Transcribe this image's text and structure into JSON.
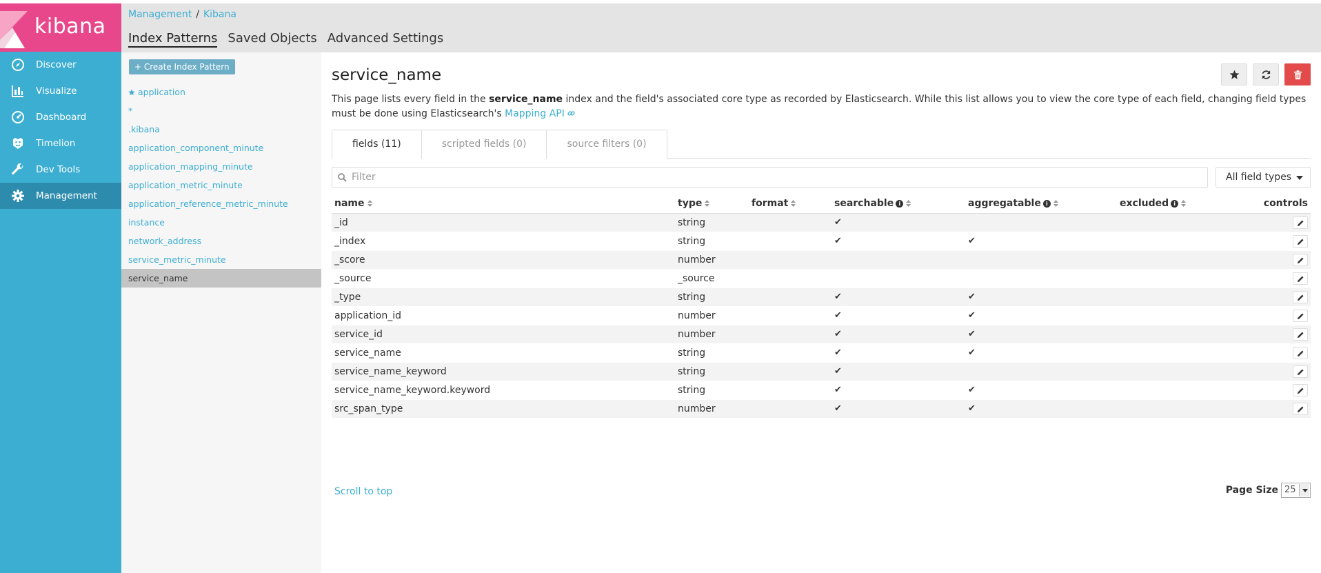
{
  "brand": {
    "name": "kibana"
  },
  "nav": [
    {
      "label": "Discover",
      "icon": "compass-icon"
    },
    {
      "label": "Visualize",
      "icon": "bar-chart-icon"
    },
    {
      "label": "Dashboard",
      "icon": "dashboard-icon"
    },
    {
      "label": "Timelion",
      "icon": "timelion-icon"
    },
    {
      "label": "Dev Tools",
      "icon": "wrench-icon"
    },
    {
      "label": "Management",
      "icon": "gear-icon",
      "active": true
    }
  ],
  "breadcrumb": {
    "first": "Management",
    "sep": "/",
    "second": "Kibana"
  },
  "tabs": {
    "index_patterns": "Index Patterns",
    "saved_objects": "Saved Objects",
    "advanced_settings": "Advanced Settings"
  },
  "index_panel": {
    "create_label": "+ Create Index Pattern",
    "items": [
      "application",
      "*",
      ".kibana",
      "application_component_minute",
      "application_mapping_minute",
      "application_metric_minute",
      "application_reference_metric_minute",
      "instance",
      "network_address",
      "service_metric_minute",
      "service_name"
    ],
    "default_item": "application",
    "active_item": "service_name"
  },
  "main": {
    "title": "service_name",
    "desc": {
      "part1": "This page lists every field in the ",
      "index": "service_name",
      "part2": " index and the field's associated core type as recorded by Elasticsearch. While this list allows you to view the core type of each field, changing field types must be done using Elasticsearch's ",
      "link": "Mapping API"
    },
    "field_tabs": {
      "fields": "fields (11)",
      "scripted": "scripted fields (0)",
      "source": "source filters (0)"
    },
    "filter_placeholder": "Filter",
    "type_select": "All field types",
    "columns": {
      "name": "name",
      "type": "type",
      "format": "format",
      "searchable": "searchable",
      "aggregatable": "aggregatable",
      "excluded": "excluded",
      "controls": "controls"
    },
    "rows": [
      {
        "name": "_id",
        "type": "string",
        "searchable": "✔",
        "aggregatable": ""
      },
      {
        "name": "_index",
        "type": "string",
        "searchable": "✔",
        "aggregatable": "✔"
      },
      {
        "name": "_score",
        "type": "number",
        "searchable": "",
        "aggregatable": ""
      },
      {
        "name": "_source",
        "type": "_source",
        "searchable": "",
        "aggregatable": ""
      },
      {
        "name": "_type",
        "type": "string",
        "searchable": "✔",
        "aggregatable": "✔"
      },
      {
        "name": "application_id",
        "type": "number",
        "searchable": "✔",
        "aggregatable": "✔"
      },
      {
        "name": "service_id",
        "type": "number",
        "searchable": "✔",
        "aggregatable": "✔"
      },
      {
        "name": "service_name",
        "type": "string",
        "searchable": "✔",
        "aggregatable": "✔"
      },
      {
        "name": "service_name_keyword",
        "type": "string",
        "searchable": "✔",
        "aggregatable": ""
      },
      {
        "name": "service_name_keyword.keyword",
        "type": "string",
        "searchable": "✔",
        "aggregatable": "✔"
      },
      {
        "name": "src_span_type",
        "type": "number",
        "searchable": "✔",
        "aggregatable": "✔"
      }
    ],
    "scroll_to_top": "Scroll to top",
    "page_size_label": "Page Size",
    "page_size_value": "25"
  }
}
